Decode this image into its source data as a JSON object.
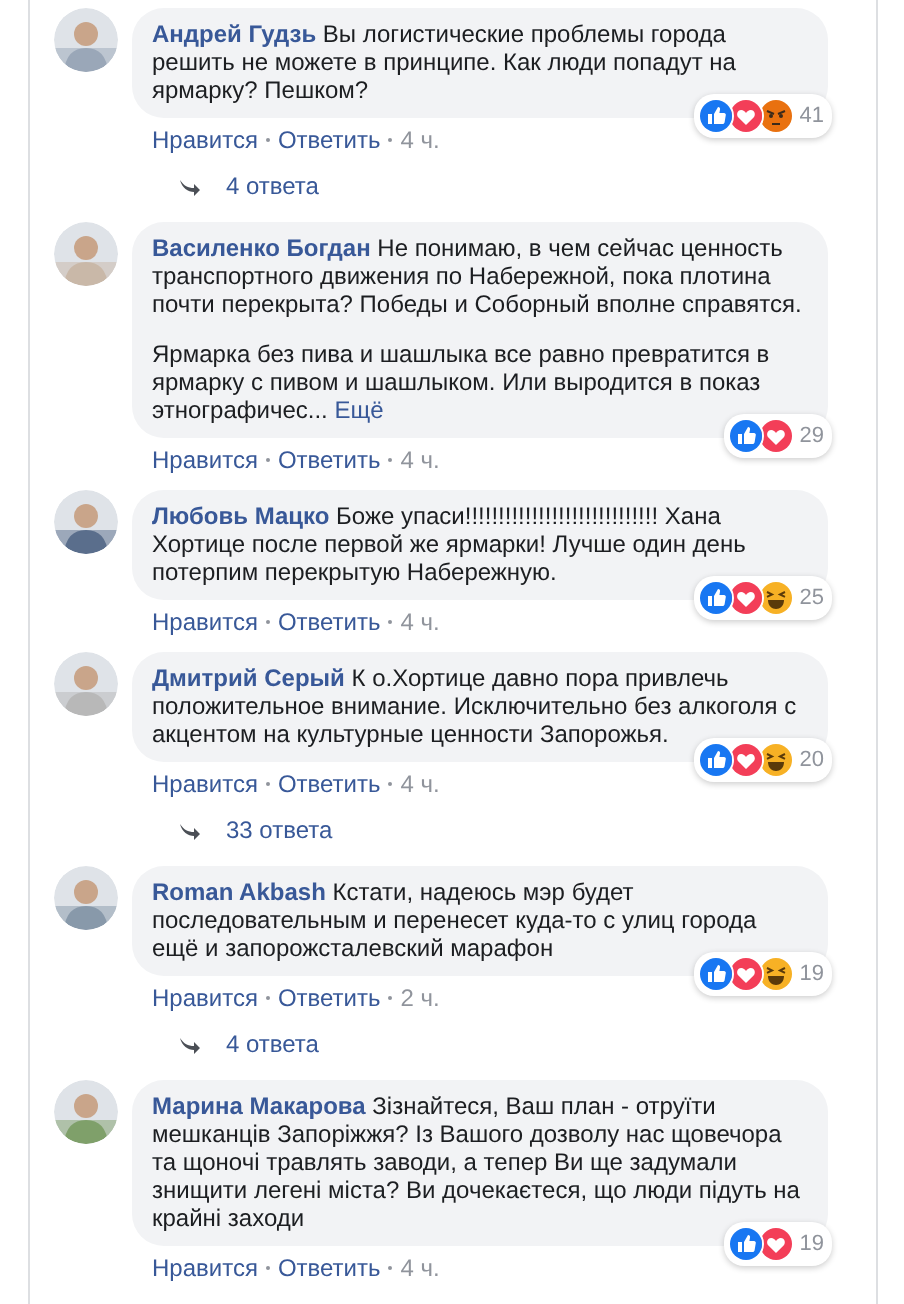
{
  "comments": [
    {
      "kind": "comment",
      "author": "Андрей Гудзь",
      "paragraphs": [
        "Вы логистические проблемы города решить не можете в принципе. Как люди попадут на ярмарку? Пешком?"
      ],
      "reactions": [
        {
          "kind": "like"
        },
        {
          "kind": "love"
        },
        {
          "kind": "angry"
        }
      ],
      "reaction_count": "41",
      "like": "Нравится",
      "reply": "Ответить",
      "time": "4 ч."
    },
    {
      "kind": "replies",
      "label": "4 ответа"
    },
    {
      "kind": "comment",
      "author": "Василенко Богдан",
      "paragraphs": [
        "Не понимаю, в чем сейчас ценность транспортного движения по Набережной, пока плотина почти перекрыта? Победы и Соборный вполне справятся.",
        "Ярмарка без пива и шашлыка все равно превратится в ярмарку с пивом и шашлыком. Или выродится в показ этнографичес..."
      ],
      "more": "Ещё",
      "reactions": [
        {
          "kind": "like"
        },
        {
          "kind": "love"
        }
      ],
      "reaction_count": "29",
      "like": "Нравится",
      "reply": "Ответить",
      "time": "4 ч."
    },
    {
      "kind": "comment",
      "author": "Любовь Мацко",
      "paragraphs": [
        "Боже упаси!!!!!!!!!!!!!!!!!!!!!!!!!!!!! Хана Хортице после первой же ярмарки! Лучше один день потерпим перекрытую Набережную."
      ],
      "reactions": [
        {
          "kind": "like"
        },
        {
          "kind": "love"
        },
        {
          "kind": "haha"
        }
      ],
      "reaction_count": "25",
      "like": "Нравится",
      "reply": "Ответить",
      "time": "4 ч."
    },
    {
      "kind": "comment",
      "author": "Дмитрий Серый",
      "paragraphs": [
        "К о.Хортице давно пора привлечь положительное внимание. Исключительно без алкоголя с акцентом на культурные ценности Запорожья."
      ],
      "reactions": [
        {
          "kind": "like"
        },
        {
          "kind": "love"
        },
        {
          "kind": "haha"
        }
      ],
      "reaction_count": "20",
      "like": "Нравится",
      "reply": "Ответить",
      "time": "4 ч."
    },
    {
      "kind": "replies",
      "label": "33 ответа"
    },
    {
      "kind": "comment",
      "author": "Roman Akbash",
      "paragraphs": [
        "Кстати, надеюсь мэр будет последовательным и перенесет куда-то с улиц города ещё и запорожсталевский марафон"
      ],
      "reactions": [
        {
          "kind": "like"
        },
        {
          "kind": "love"
        },
        {
          "kind": "haha"
        }
      ],
      "reaction_count": "19",
      "like": "Нравится",
      "reply": "Ответить",
      "time": "2 ч."
    },
    {
      "kind": "replies",
      "label": "4 ответа"
    },
    {
      "kind": "comment",
      "author": "Марина Макарова",
      "paragraphs": [
        "Зізнайтеся, Ваш план - отруїти мешканців Запоріжжя? Із Вашого дозволу нас щовечора та щоночі травлять заводи, а тепер Ви ще задумали знищити легені міста? Ви дочекаєтеся, що люди підуть на крайні заходи"
      ],
      "reactions": [
        {
          "kind": "like"
        },
        {
          "kind": "love"
        }
      ],
      "reaction_count": "19",
      "like": "Нравится",
      "reply": "Ответить",
      "time": "4 ч."
    }
  ]
}
